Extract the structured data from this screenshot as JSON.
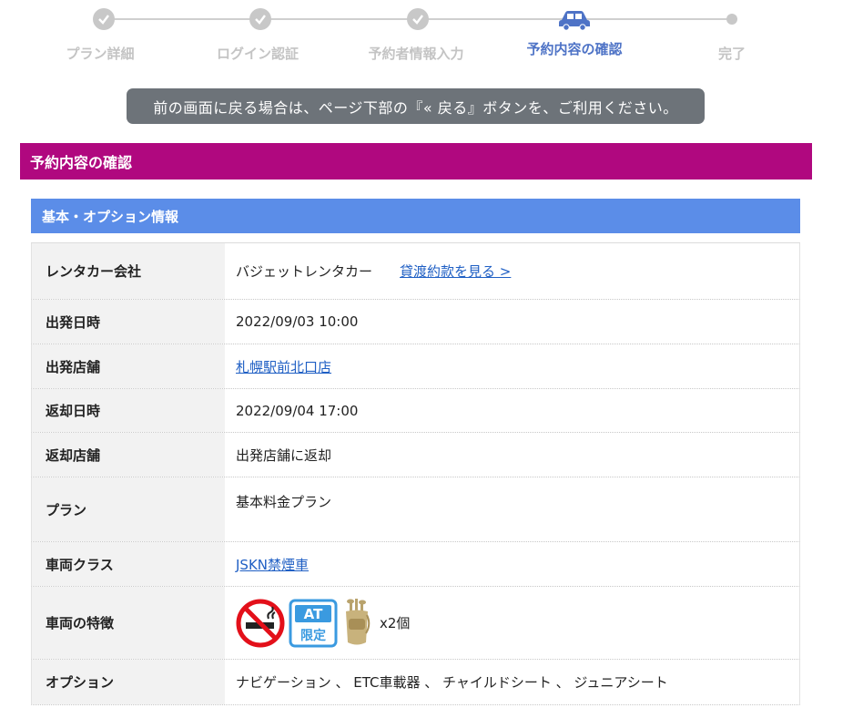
{
  "stepper": {
    "steps": [
      {
        "label": "プラン詳細",
        "state": "done"
      },
      {
        "label": "ログイン認証",
        "state": "done"
      },
      {
        "label": "予約者情報入力",
        "state": "done"
      },
      {
        "label": "予約内容の確認",
        "state": "active"
      },
      {
        "label": "完了",
        "state": "pending"
      }
    ]
  },
  "notice": "前の画面に戻る場合は、ページ下部の『« 戻る』ボタンを、ご利用ください。",
  "section": {
    "title": "予約内容の確認",
    "color": "#b0087f"
  },
  "subsection": {
    "title": "基本・オプション情報",
    "color": "#5b8de8"
  },
  "info": {
    "company": {
      "label": "レンタカー会社",
      "value": "バジェットレンタカー",
      "terms_link": "貸渡約款を見る >"
    },
    "departure_datetime": {
      "label": "出発日時",
      "value": "2022/09/03 10:00"
    },
    "departure_store": {
      "label": "出発店舗",
      "value": "札幌駅前北口店"
    },
    "return_datetime": {
      "label": "返却日時",
      "value": "2022/09/04 17:00"
    },
    "return_store": {
      "label": "返却店舗",
      "value": "出発店舗に返却"
    },
    "plan": {
      "label": "プラン",
      "value": "基本料金プラン"
    },
    "vehicle_class": {
      "label": "車両クラス",
      "value": "JSKN禁煙車"
    },
    "features": {
      "label": "車両の特徴",
      "icons": [
        "no-smoking-icon",
        "at-only-icon",
        "golf-bag-icon"
      ],
      "at_text_1": "AT",
      "at_text_2": "限定",
      "golf_count": "x2個"
    },
    "options": {
      "label": "オプション",
      "value": "ナビゲーション 、 ETC車載器 、 チャイルドシート 、 ジュニアシート"
    }
  },
  "colors": {
    "link": "#1f5fc4",
    "active_step": "#4e73c6",
    "notice_bg": "#6d7379"
  }
}
